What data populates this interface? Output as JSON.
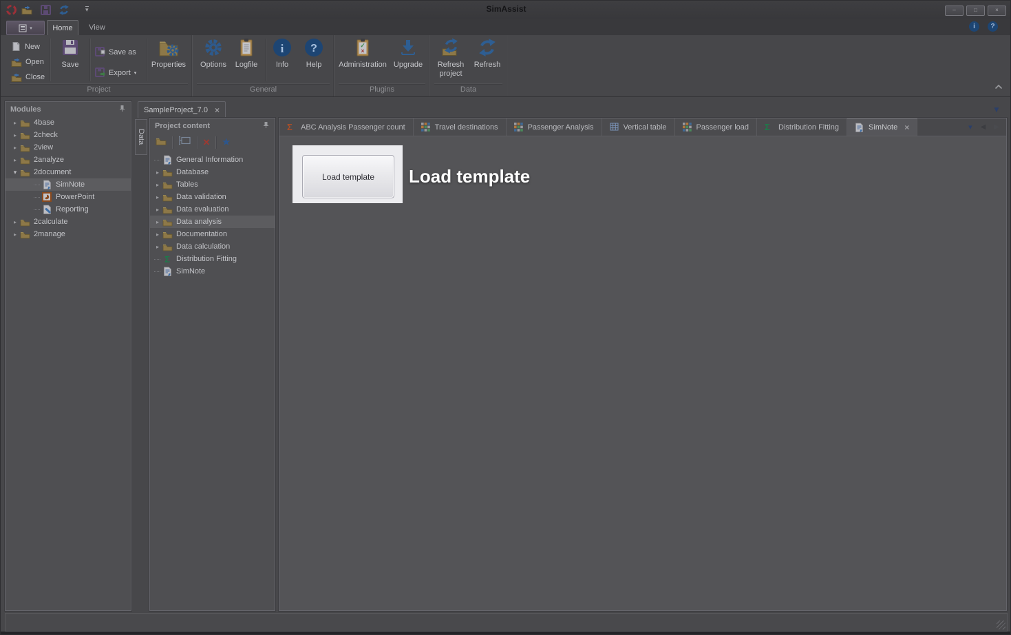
{
  "window": {
    "title": "SimAssist",
    "controls": {
      "minimize": "–",
      "maximize": "□",
      "close": "×"
    }
  },
  "quick_access": {
    "dropdown_glyph": "▾"
  },
  "menu": {
    "tabs": [
      {
        "label": "Home",
        "active": true
      },
      {
        "label": "View",
        "active": false
      }
    ]
  },
  "top_right": {
    "info_glyph": "i",
    "help_glyph": "?"
  },
  "ribbon": {
    "groups": [
      {
        "label": "Project"
      },
      {
        "label": "General"
      },
      {
        "label": "Plugins"
      },
      {
        "label": "Data"
      }
    ],
    "buttons": {
      "new": "New",
      "open": "Open",
      "close": "Close",
      "save": "Save",
      "save_as": "Save as",
      "export": "Export",
      "export_arrow": "▾",
      "properties": "Properties",
      "options": "Options",
      "logfile": "Logfile",
      "info": "Info",
      "help": "Help",
      "administration": "Administration",
      "upgrade": "Upgrade",
      "refresh_project": "Refresh project",
      "refresh": "Refresh"
    }
  },
  "project_tab": {
    "label": "SampleProject_7.0",
    "close_glyph": "×"
  },
  "data_side_tab": {
    "label": "Data"
  },
  "modules_panel": {
    "title": "Modules",
    "items": [
      {
        "label": "4base",
        "icon": "folder",
        "level": 0,
        "arrow": "collapsed"
      },
      {
        "label": "2check",
        "icon": "folder",
        "level": 0,
        "arrow": "collapsed"
      },
      {
        "label": "2view",
        "icon": "folder",
        "level": 0,
        "arrow": "collapsed"
      },
      {
        "label": "2analyze",
        "icon": "folder",
        "level": 0,
        "arrow": "collapsed"
      },
      {
        "label": "2document",
        "icon": "folder",
        "level": 0,
        "arrow": "expanded"
      },
      {
        "label": "SimNote",
        "icon": "simnote",
        "level": 1,
        "selected": true
      },
      {
        "label": "PowerPoint",
        "icon": "powerpoint",
        "level": 1
      },
      {
        "label": "Reporting",
        "icon": "reporting",
        "level": 1
      },
      {
        "label": "2calculate",
        "icon": "folder",
        "level": 0,
        "arrow": "collapsed"
      },
      {
        "label": "2manage",
        "icon": "folder",
        "level": 0,
        "arrow": "collapsed"
      }
    ]
  },
  "project_content_panel": {
    "title": "Project content",
    "items": [
      {
        "label": "General Information",
        "icon": "doc"
      },
      {
        "label": "Database",
        "icon": "folder",
        "arrow": "collapsed"
      },
      {
        "label": "Tables",
        "icon": "folder",
        "arrow": "collapsed"
      },
      {
        "label": "Data validation",
        "icon": "folder",
        "arrow": "collapsed"
      },
      {
        "label": "Data evaluation",
        "icon": "folder",
        "arrow": "collapsed"
      },
      {
        "label": "Data analysis",
        "icon": "folder",
        "arrow": "collapsed",
        "selected": true
      },
      {
        "label": "Documentation",
        "icon": "folder",
        "arrow": "collapsed"
      },
      {
        "label": "Data calculation",
        "icon": "folder",
        "arrow": "collapsed"
      },
      {
        "label": "Distribution Fitting",
        "icon": "sigma-green"
      },
      {
        "label": "SimNote",
        "icon": "doc"
      }
    ]
  },
  "document_tabs": {
    "close_glyph": "×",
    "tabs": [
      {
        "label": "ABC Analysis Passenger count",
        "icon": "sigma-orange"
      },
      {
        "label": "Travel destinations",
        "icon": "pivot-grid"
      },
      {
        "label": "Passenger Analysis",
        "icon": "pivot-grid"
      },
      {
        "label": "Vertical table",
        "icon": "table-blue"
      },
      {
        "label": "Passenger load",
        "icon": "pivot-grid"
      },
      {
        "label": "Distribution Fitting",
        "icon": "sigma-green"
      },
      {
        "label": "SimNote",
        "icon": "doc",
        "active": true,
        "closable": true
      }
    ],
    "nav": {
      "dropdown": "▾",
      "prev": "◀",
      "next": "▶"
    }
  },
  "spotlight": {
    "button_label": "Load template",
    "annotation": "Load template"
  },
  "colors": {
    "accent_blue": "#2e5e92",
    "sigma_green": "#1e7a4a",
    "sigma_orange": "#a84e28",
    "folder_tan": "#8d7848",
    "floppy_purple": "#5c4a73",
    "logo_red": "#9c3038",
    "spotlight_bg": "#ececef",
    "annotation_text": "#ffffff",
    "selected_row": "#5c5c5f"
  }
}
